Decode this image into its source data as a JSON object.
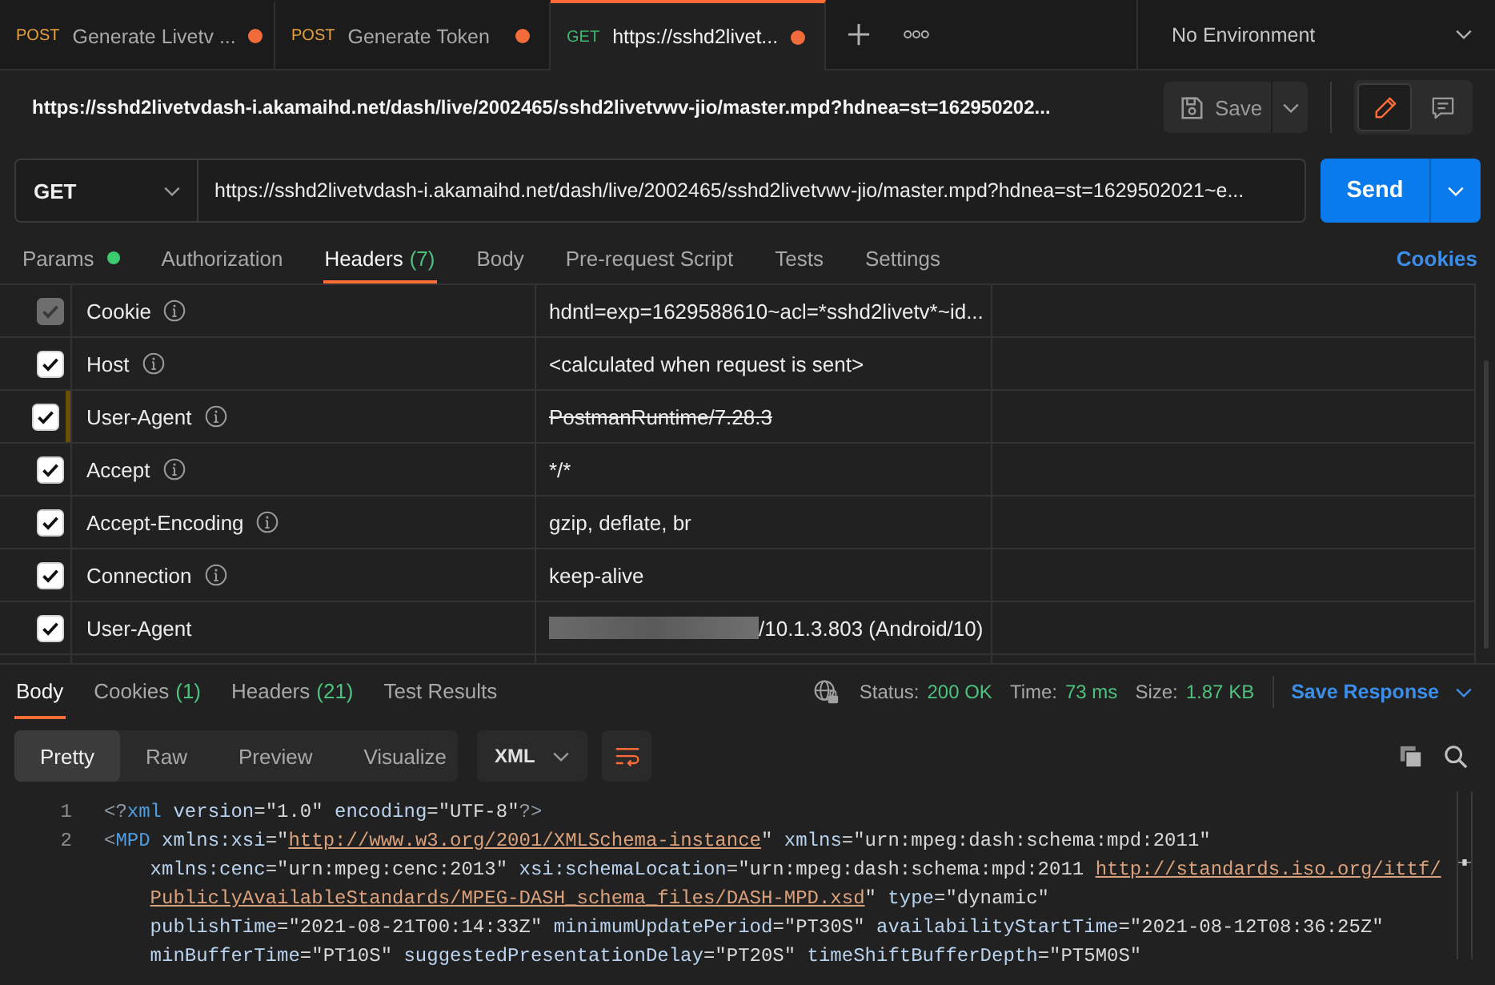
{
  "tabs": [
    {
      "method": "POST",
      "color": "#e9a23b",
      "title": "Generate Livetv ...",
      "unsaved": true,
      "selected": false
    },
    {
      "method": "POST",
      "color": "#e9a23b",
      "title": "Generate Token",
      "unsaved": true,
      "selected": false
    },
    {
      "method": "GET",
      "color": "#3eb86f",
      "title": "https://sshd2livet...",
      "unsaved": true,
      "selected": true
    }
  ],
  "environment": {
    "label": "No Environment"
  },
  "request": {
    "title": "https://sshd2livetvdash-i.akamaihd.net/dash/live/2002465/sshd2livetvwv-jio/master.mpd?hdnea=st=162950202...",
    "save_label": "Save",
    "view_modes": [
      {
        "kind": "edit",
        "selected": true
      },
      {
        "kind": "comments",
        "selected": false
      }
    ],
    "method": "GET",
    "url": "https://sshd2livetvdash-i.akamaihd.net/dash/live/2002465/sshd2livetvwv-jio/master.mpd?hdnea=st=1629502021~e...",
    "send_label": "Send"
  },
  "request_tabs": [
    {
      "label": "Params",
      "dot": true,
      "selected": false
    },
    {
      "label": "Authorization",
      "dot": false,
      "selected": false
    },
    {
      "label": "Headers",
      "count": "(7)",
      "dot": false,
      "selected": true
    },
    {
      "label": "Body",
      "dot": false,
      "selected": false
    },
    {
      "label": "Pre-request Script",
      "dot": false,
      "selected": false
    },
    {
      "label": "Tests",
      "dot": false,
      "selected": false
    },
    {
      "label": "Settings",
      "dot": false,
      "selected": false
    }
  ],
  "cookies_link": "Cookies",
  "headers": [
    {
      "key": "Cookie",
      "value": "hdntl=exp=1629588610~acl=*sshd2livetv*~id...",
      "checked": true,
      "disabled": true,
      "info": true,
      "overridden": false,
      "redacted": false
    },
    {
      "key": "Host",
      "value": "<calculated when request is sent>",
      "checked": true,
      "disabled": false,
      "info": true,
      "overridden": false,
      "redacted": false
    },
    {
      "key": "User-Agent",
      "value": "PostmanRuntime/7.28.3",
      "checked": true,
      "disabled": false,
      "info": true,
      "overridden": true,
      "redacted": false
    },
    {
      "key": "Accept",
      "value": "*/*",
      "checked": true,
      "disabled": false,
      "info": true,
      "overridden": false,
      "redacted": false
    },
    {
      "key": "Accept-Encoding",
      "value": "gzip, deflate, br",
      "checked": true,
      "disabled": false,
      "info": true,
      "overridden": false,
      "redacted": false
    },
    {
      "key": "Connection",
      "value": "keep-alive",
      "checked": true,
      "disabled": false,
      "info": true,
      "overridden": false,
      "redacted": false
    },
    {
      "key": "User-Agent",
      "value": "/10.1.3.803 (Android/10)",
      "checked": true,
      "disabled": false,
      "info": false,
      "overridden": false,
      "redacted": true
    }
  ],
  "response": {
    "tabs": [
      {
        "label": "Body",
        "selected": true
      },
      {
        "label": "Cookies",
        "count": "(1)",
        "selected": false
      },
      {
        "label": "Headers",
        "count": "(21)",
        "selected": false
      },
      {
        "label": "Test Results",
        "selected": false
      }
    ],
    "status": [
      {
        "label": "Status:",
        "value": "200 OK"
      },
      {
        "label": "Time:",
        "value": "73 ms"
      },
      {
        "label": "Size:",
        "value": "1.87 KB"
      }
    ],
    "save_label": "Save Response",
    "formats": [
      {
        "label": "Pretty",
        "selected": true
      },
      {
        "label": "Raw",
        "selected": false
      },
      {
        "label": "Preview",
        "selected": false
      },
      {
        "label": "Visualize",
        "selected": false
      }
    ],
    "language": "XML",
    "wrap": true
  },
  "code": {
    "lines": [
      {
        "number": "1",
        "rows": [
          {
            "tokens": [
              {
                "kind": "punct",
                "text": "<?"
              },
              {
                "kind": "tag",
                "text": "xml"
              },
              {
                "kind": "attr",
                "text": " version"
              },
              {
                "kind": "value",
                "text": "=\"1.0\""
              },
              {
                "kind": "attr",
                "text": " encoding"
              },
              {
                "kind": "value",
                "text": "=\"UTF-8\""
              },
              {
                "kind": "punct",
                "text": "?>"
              }
            ]
          }
        ]
      },
      {
        "number": "2",
        "rows": [
          {
            "tokens": [
              {
                "kind": "punct",
                "text": "<"
              },
              {
                "kind": "tag",
                "text": "MPD"
              },
              {
                "kind": "attr",
                "text": " xmlns:xsi"
              },
              {
                "kind": "value",
                "text": "=\""
              },
              {
                "kind": "link",
                "text": "http://www.w3.org/2001/XMLSchema-instance"
              },
              {
                "kind": "value",
                "text": "\""
              },
              {
                "kind": "attr",
                "text": " xmlns"
              },
              {
                "kind": "value",
                "text": "=\"urn:mpeg:dash:schema:mpd:2011\""
              }
            ]
          },
          {
            "tokens": [
              {
                "kind": "attr",
                "text": "xmlns:cenc"
              },
              {
                "kind": "value",
                "text": "=\"urn:mpeg:cenc:2013\""
              },
              {
                "kind": "attr",
                "text": " xsi:schemaLocation"
              },
              {
                "kind": "value",
                "text": "=\"urn:mpeg:dash:schema:mpd:2011 "
              },
              {
                "kind": "link",
                "text": "http://standards.iso.org/ittf/"
              }
            ]
          },
          {
            "tokens": [
              {
                "kind": "link",
                "text": "PubliclyAvailableStandards/MPEG-DASH_schema_files/DASH-MPD.xsd"
              },
              {
                "kind": "value",
                "text": "\""
              },
              {
                "kind": "attr",
                "text": " type"
              },
              {
                "kind": "value",
                "text": "=\"dynamic\""
              }
            ]
          },
          {
            "tokens": [
              {
                "kind": "attr",
                "text": "publishTime"
              },
              {
                "kind": "value",
                "text": "=\"2021-08-21T00:14:33Z\""
              },
              {
                "kind": "attr",
                "text": " minimumUpdatePeriod"
              },
              {
                "kind": "value",
                "text": "=\"PT30S\""
              },
              {
                "kind": "attr",
                "text": " availabilityStartTime"
              },
              {
                "kind": "value",
                "text": "=\"2021-08-12T08:36:25Z\""
              }
            ]
          },
          {
            "tokens": [
              {
                "kind": "attr",
                "text": "minBufferTime"
              },
              {
                "kind": "value",
                "text": "=\"PT10S\""
              },
              {
                "kind": "attr",
                "text": " suggestedPresentationDelay"
              },
              {
                "kind": "value",
                "text": "=\"PT20S\""
              },
              {
                "kind": "attr",
                "text": " timeShiftBufferDepth"
              },
              {
                "kind": "value",
                "text": "=\"PT5M0S\""
              }
            ]
          }
        ]
      }
    ]
  }
}
